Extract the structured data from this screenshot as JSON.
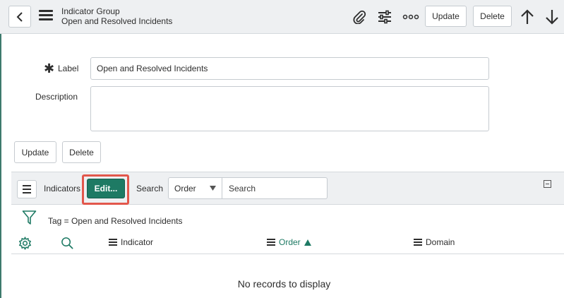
{
  "header": {
    "title": "Indicator Group",
    "subtitle": "Open and Resolved Incidents",
    "update_label": "Update",
    "delete_label": "Delete",
    "icons": [
      "chevron-left-icon",
      "hamburger-icon",
      "paperclip-icon",
      "sliders-icon",
      "more-icon",
      "arrow-up-icon",
      "arrow-down-icon"
    ]
  },
  "form": {
    "label_label": "Label",
    "label_value": "Open and Resolved Incidents",
    "description_label": "Description",
    "description_value": "",
    "update_label": "Update",
    "delete_label": "Delete"
  },
  "related_list": {
    "title": "Indicators",
    "edit_label": "Edit...",
    "search_label": "Search",
    "search_field": "Order",
    "search_placeholder": "Search",
    "filter_text": "Tag = Open and Resolved Incidents",
    "columns": [
      {
        "label": "Indicator",
        "sorted": false
      },
      {
        "label": "Order",
        "sorted": true,
        "direction": "ascending"
      },
      {
        "label": "Domain",
        "sorted": false
      }
    ],
    "empty_message": "No records to display"
  },
  "colors": {
    "accent": "#1e7a64",
    "highlight": "#e2574c",
    "header_bg": "#eef0f2"
  }
}
